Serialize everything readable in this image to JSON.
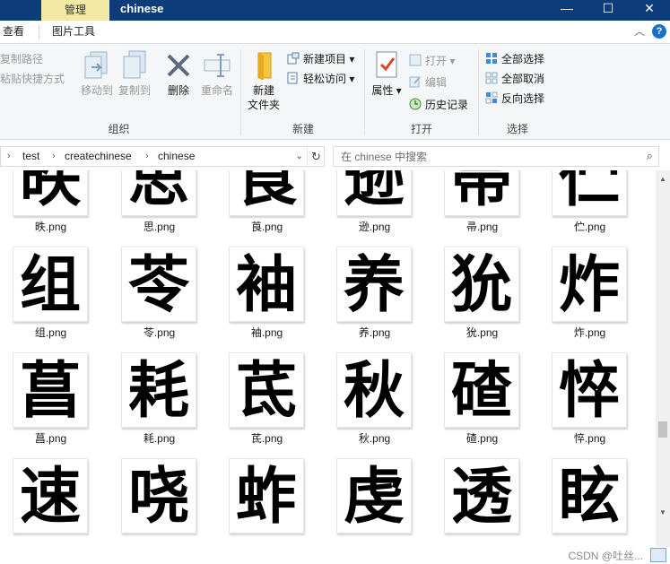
{
  "window": {
    "context_tab": "管理",
    "title": "chinese",
    "min_glyph": "—",
    "max_glyph": "☐",
    "close_glyph": "✕"
  },
  "tabs": {
    "view": "查看",
    "picture_tools": "图片工具",
    "help": "?"
  },
  "ribbon": {
    "organize": {
      "label": "组织",
      "copy_path": "复制路径",
      "paste_shortcut": "粘贴快捷方式",
      "move_to": "移动到",
      "copy_to": "复制到",
      "delete": "删除",
      "rename": "重命名"
    },
    "new": {
      "label": "新建",
      "new_folder_line1": "新建",
      "new_folder_line2": "文件夹",
      "new_item": "新建项目",
      "easy_access": "轻松访问"
    },
    "open": {
      "label": "打开",
      "properties": "属性",
      "open": "打开",
      "edit": "编辑",
      "history": "历史记录"
    },
    "select": {
      "label": "选择",
      "select_all": "全部选择",
      "select_none": "全部取消",
      "invert": "反向选择"
    }
  },
  "address": {
    "crumbs": [
      "test",
      "createchinese",
      "chinese"
    ],
    "search_placeholder": "在 chinese 中搜索"
  },
  "files": [
    {
      "glyph": "昳",
      "name": "昳.png"
    },
    {
      "glyph": "思",
      "name": "思.png"
    },
    {
      "glyph": "莨",
      "name": "莨.png"
    },
    {
      "glyph": "逊",
      "name": "逊.png"
    },
    {
      "glyph": "帚",
      "name": "帚.png"
    },
    {
      "glyph": "伫",
      "name": "伫.png"
    },
    {
      "glyph": "组",
      "name": "组.png"
    },
    {
      "glyph": "苓",
      "name": "苓.png"
    },
    {
      "glyph": "袖",
      "name": "袖.png"
    },
    {
      "glyph": "养",
      "name": "养.png"
    },
    {
      "glyph": "狁",
      "name": "狁.png"
    },
    {
      "glyph": "炸",
      "name": "炸.png"
    },
    {
      "glyph": "菖",
      "name": "菖.png"
    },
    {
      "glyph": "耗",
      "name": "耗.png"
    },
    {
      "glyph": "茋",
      "name": "茋.png"
    },
    {
      "glyph": "秋",
      "name": "秋.png"
    },
    {
      "glyph": "碴",
      "name": "碴.png"
    },
    {
      "glyph": "悴",
      "name": "悴.png"
    },
    {
      "glyph": "速",
      "name": ""
    },
    {
      "glyph": "哓",
      "name": ""
    },
    {
      "glyph": "蚱",
      "name": ""
    },
    {
      "glyph": "虔",
      "name": ""
    },
    {
      "glyph": "透",
      "name": ""
    },
    {
      "glyph": "眩",
      "name": ""
    }
  ],
  "status": {
    "watermark": "CSDN @吐丝..."
  },
  "colors": {
    "titlebar": "#0c3d7a",
    "context_tab": "#f4e9a4",
    "accent": "#1c6fc7"
  },
  "icons": {
    "move_to": "move-to-icon",
    "copy_to": "copy-to-icon",
    "delete": "delete-x-icon",
    "rename": "rename-icon",
    "new_folder": "folder-icon",
    "properties": "properties-check-icon",
    "history": "history-icon",
    "select_all": "grid-icon",
    "search": "magnifier-icon",
    "refresh": "refresh-icon"
  }
}
